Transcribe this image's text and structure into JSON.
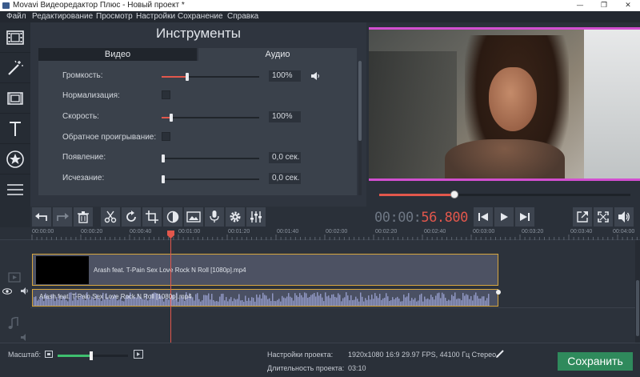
{
  "window": {
    "title": "Movavi Видеоредактор Плюс - Новый проект *"
  },
  "menu": [
    "Файл",
    "Редактирование",
    "Просмотр",
    "Настройки",
    "Сохранение",
    "Справка"
  ],
  "tools": {
    "title": "Инструменты",
    "tabs": [
      "Видео",
      "Аудио"
    ],
    "rows": {
      "volume": {
        "label": "Громкость:",
        "value": "100%",
        "level": 0.26
      },
      "normalize": {
        "label": "Нормализация:"
      },
      "speed": {
        "label": "Скорость:",
        "value": "100%",
        "level": 0.1
      },
      "reverse": {
        "label": "Обратное проигрывание:"
      },
      "fade_in": {
        "label": "Появление:",
        "value": "0,0 сек.",
        "level": 0
      },
      "fade_out": {
        "label": "Исчезание:",
        "value": "0,0 сек.",
        "level": 0
      }
    }
  },
  "player": {
    "progress": 0.3,
    "timecode_dim": "00:00:",
    "timecode_hot": "56.800"
  },
  "timeline": {
    "ticks": [
      "00:00:00",
      "00:00:20",
      "00:00:40",
      "00:01:00",
      "00:01:20",
      "00:01:40",
      "00:02:00",
      "00:02:20",
      "00:02:40",
      "00:03:00",
      "00:03:20",
      "00:03:40",
      "00:04:00"
    ],
    "video_clip": "Arash feat. T-Pain Sex Love Rock N Roll [1080p].mp4",
    "audio_clip": "Arash feat. T-Pain Sex Love Rock N Roll [1080p].mp4"
  },
  "footer": {
    "zoom_label": "Масштаб:",
    "zoom_level": 0.48,
    "settings_label": "Настройки проекта:",
    "settings_value": "1920x1080 16:9 29.97 FPS, 44100 Гц Стерео",
    "duration_label": "Длительность проекта:",
    "duration_value": "03:10",
    "save_label": "Сохранить"
  },
  "icons": {
    "leftbar": [
      "film-icon",
      "magic-wand-icon",
      "clip-icon",
      "text-icon",
      "star-icon",
      "menu-icon"
    ],
    "toolbar": [
      "undo-icon",
      "redo-icon",
      "trash-icon",
      "scissors-icon",
      "rotate-icon",
      "crop-icon",
      "color-icon",
      "image-icon",
      "mic-icon",
      "gear-icon",
      "equalizer-icon"
    ],
    "accent": "#e2574c",
    "save_color": "#2f8a5c"
  }
}
